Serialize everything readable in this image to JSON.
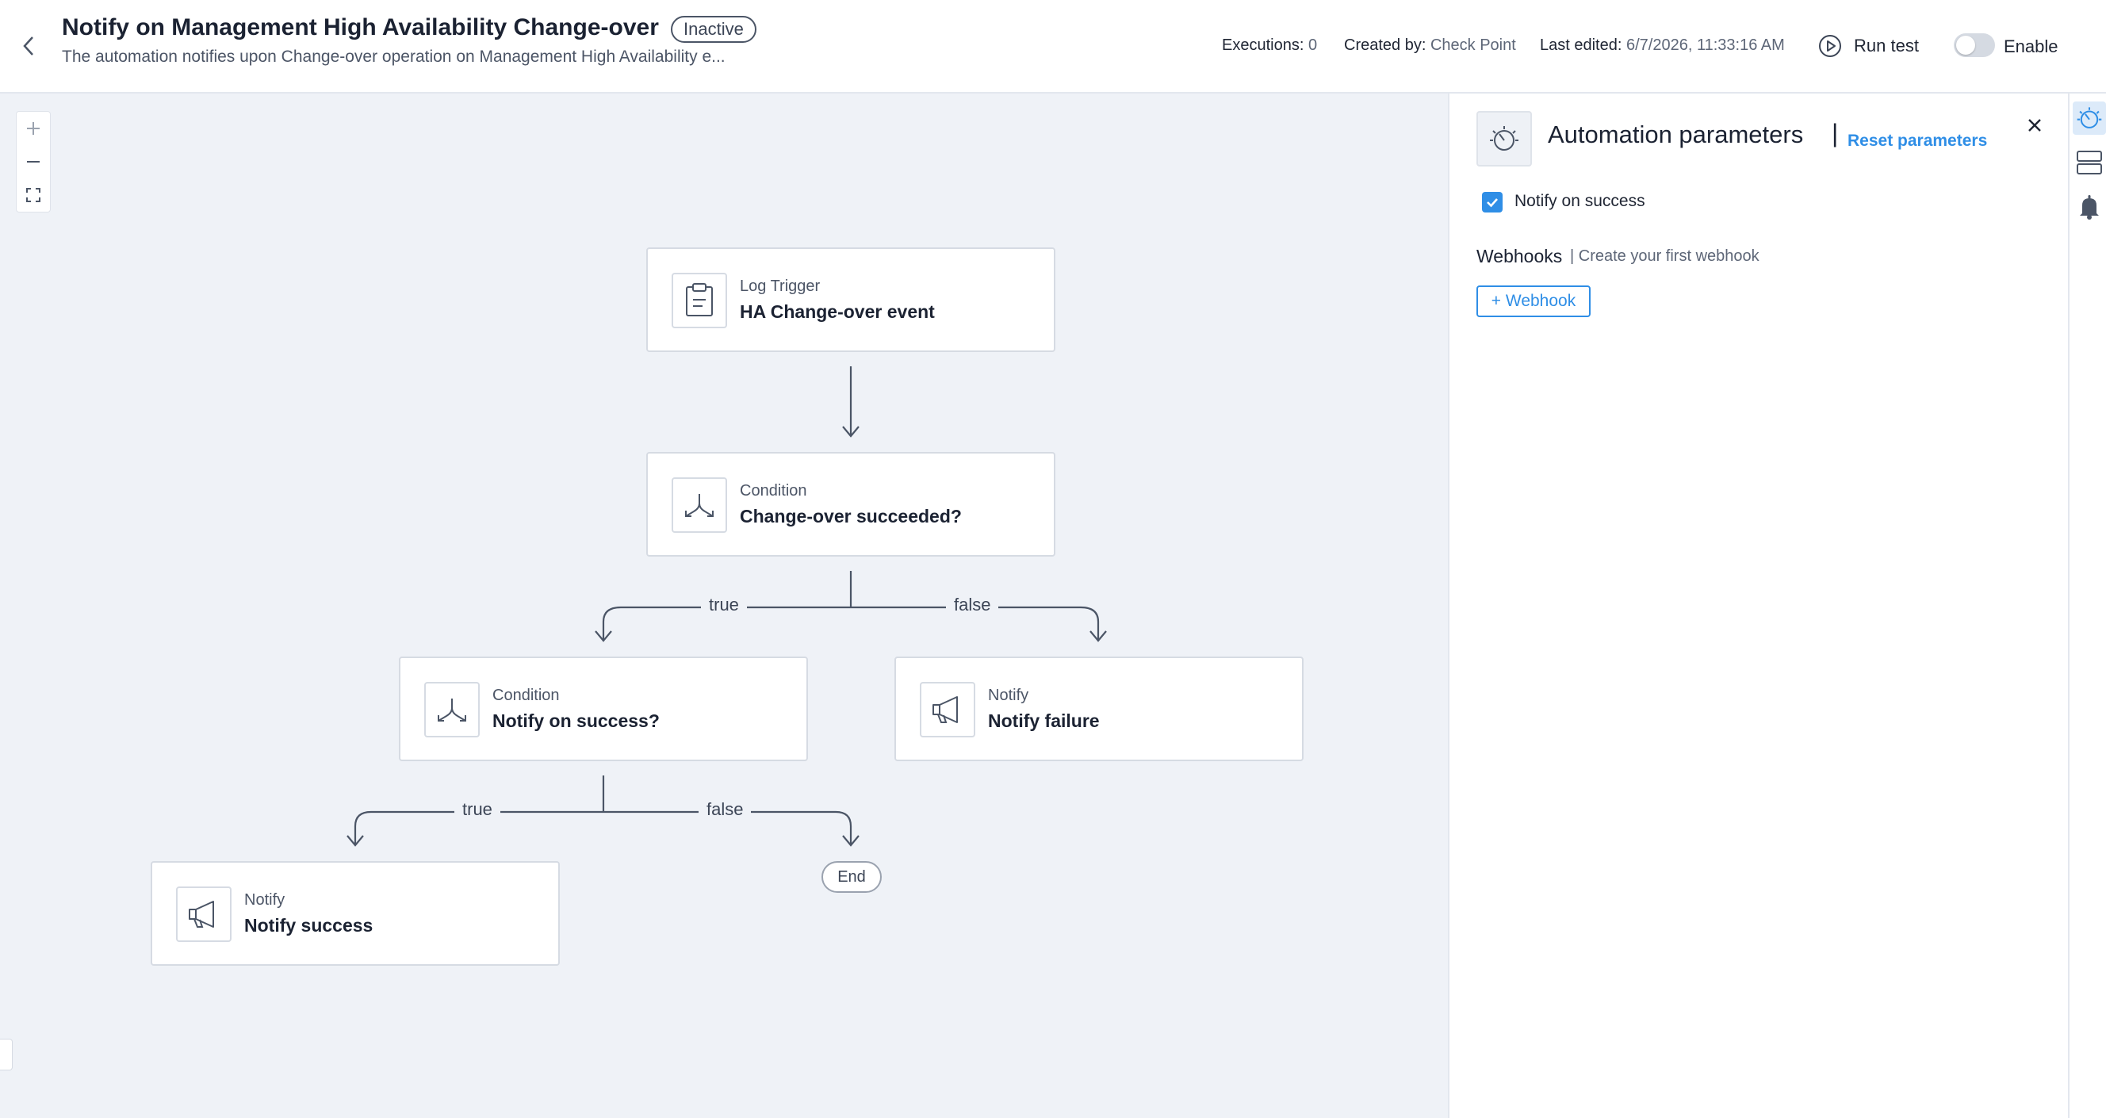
{
  "header": {
    "title": "Notify on Management High Availability Change-over",
    "status": "Inactive",
    "description": "The automation notifies upon Change-over operation on Management High Availability e...",
    "executions_label": "Executions:",
    "executions_value": "0",
    "created_by_label": "Created by:",
    "created_by_value": "Check Point",
    "last_edited_label": "Last edited:",
    "last_edited_value": "6/7/2026, 11:33:16 AM",
    "run_test_label": "Run test",
    "enable_label": "Enable",
    "enabled": false
  },
  "canvas": {
    "zoom_controls": [
      "+",
      "−",
      "fit"
    ],
    "nodes": {
      "trigger": {
        "type": "Log Trigger",
        "name": "HA Change-over event",
        "icon": "clipboard-icon"
      },
      "condition1": {
        "type": "Condition",
        "name": "Change-over succeeded?",
        "icon": "split-arrows-icon"
      },
      "condition2": {
        "type": "Condition",
        "name": "Notify on success?",
        "icon": "split-arrows-icon"
      },
      "notify_failure": {
        "type": "Notify",
        "name": "Notify failure",
        "icon": "megaphone-icon"
      },
      "notify_success": {
        "type": "Notify",
        "name": "Notify success",
        "icon": "megaphone-icon"
      },
      "end": {
        "label": "End"
      }
    },
    "edge_labels": {
      "c1_true": "true",
      "c1_false": "false",
      "c2_true": "true",
      "c2_false": "false"
    }
  },
  "panel": {
    "title": "Automation parameters",
    "separator": "|",
    "reset_label": "Reset parameters",
    "notify_on_success_label": "Notify on success",
    "notify_on_success_checked": true,
    "webhooks_title": "Webhooks",
    "webhooks_hint": "| Create your first webhook",
    "add_webhook_label": "+ Webhook"
  },
  "colors": {
    "accent": "#2f8ee6",
    "canvas_bg": "#eff2f7",
    "edge": "#4b5566"
  }
}
